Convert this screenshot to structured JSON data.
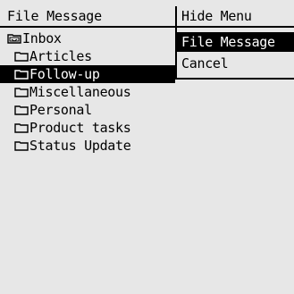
{
  "header": {
    "title": "File Message"
  },
  "folders": [
    {
      "label": "Inbox",
      "icon": "inbox-icon",
      "selected": false
    },
    {
      "label": "Articles",
      "icon": "folder-icon",
      "selected": false
    },
    {
      "label": "Follow-up",
      "icon": "folder-icon",
      "selected": true
    },
    {
      "label": "Miscellaneous",
      "icon": "folder-icon",
      "selected": false
    },
    {
      "label": "Personal",
      "icon": "folder-icon",
      "selected": false
    },
    {
      "label": "Product tasks",
      "icon": "folder-icon",
      "selected": false
    },
    {
      "label": "Status Update",
      "icon": "folder-icon",
      "selected": false
    }
  ],
  "menu": {
    "hide_menu": "Hide Menu",
    "file_message": "File Message",
    "cancel": "Cancel"
  },
  "colors": {
    "background": "#e7e7e7",
    "foreground": "#000000",
    "highlight_text": "#ffffff"
  }
}
